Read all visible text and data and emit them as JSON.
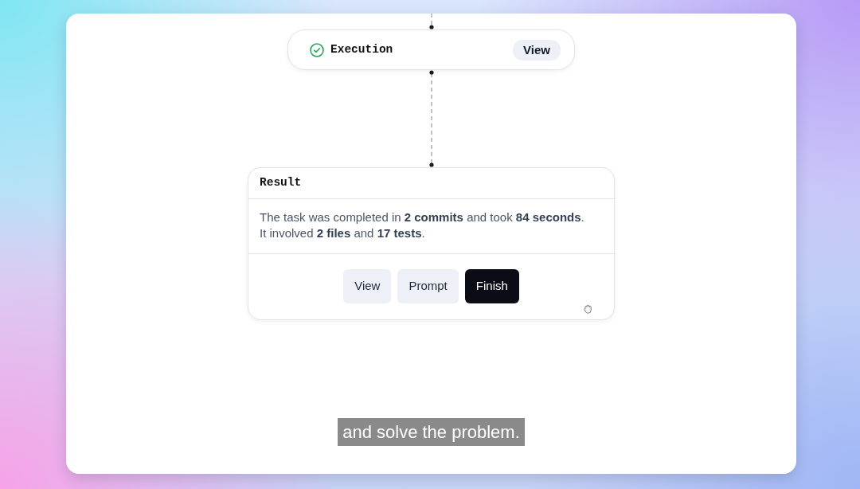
{
  "execution_node": {
    "title": "Execution",
    "completed": true,
    "button": "View"
  },
  "result_card": {
    "title": "Result",
    "message": "The task was completed in **2 commits** and took **84 seconds**.\nIt involved **2 files** and **17 tests**.",
    "buttons": [
      {
        "label": "View",
        "kind": "secondary"
      },
      {
        "label": "Prompt",
        "kind": "secondary"
      },
      {
        "label": "Finish",
        "kind": "primary"
      }
    ]
  },
  "subtitle": "and solve the problem."
}
